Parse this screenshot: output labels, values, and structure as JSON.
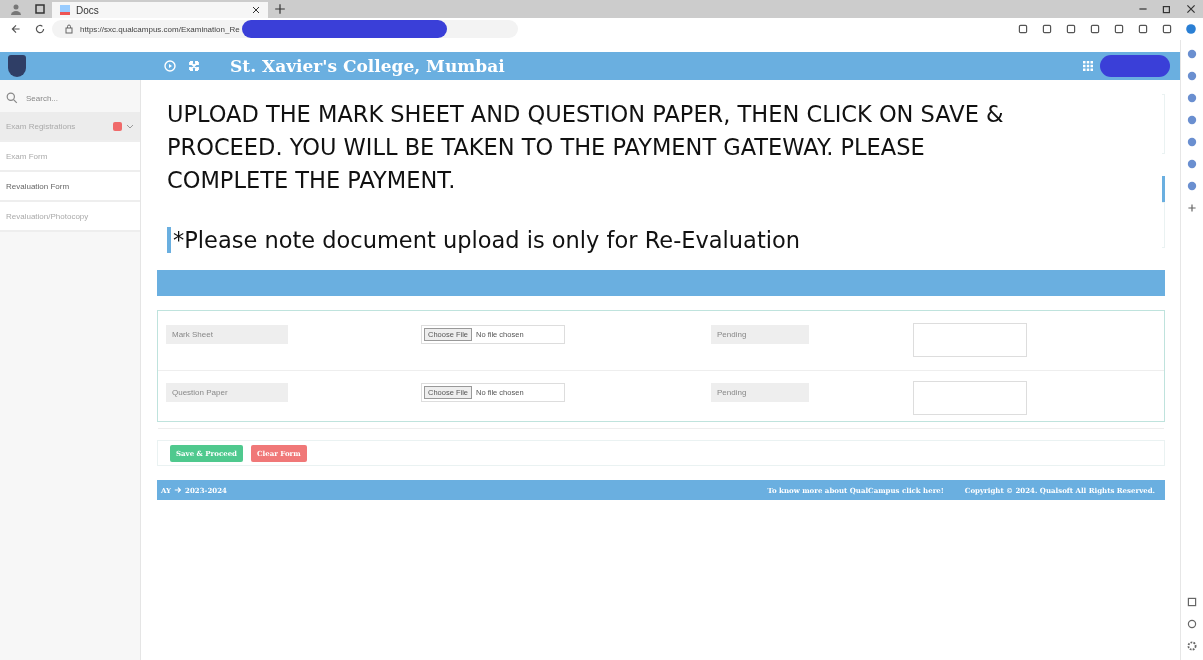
{
  "browser": {
    "tabs": [
      {
        "label": "Docs",
        "selected": true
      }
    ],
    "url": "https://sxc.qualcampus.com/Examination_Re"
  },
  "header": {
    "title": "St. Xavier's College, Mumbai"
  },
  "sidebar": {
    "search_placeholder": "Search...",
    "items": [
      {
        "label": "Exam Registrations",
        "selected": false,
        "expanded": true
      },
      {
        "label": "Exam Form",
        "selected": false,
        "expanded": false
      },
      {
        "label": "Revaluation Form",
        "selected": true,
        "expanded": false
      },
      {
        "label": "Revaluation/Photocopy",
        "selected": false,
        "expanded": false
      }
    ]
  },
  "notice": {
    "instruction": "UPLOAD THE MARK SHEET AND QUESTION PAPER, THEN CLICK ON SAVE & PROCEED. YOU WILL BE TAKEN TO THE PAYMENT GATEWAY. PLEASE COMPLETE THE PAYMENT.",
    "note": "*Please note document upload is only for Re-Evaluation"
  },
  "table": {
    "rows": [
      {
        "document": "Mark Sheet",
        "file_button": "Choose File",
        "file_status": "No file chosen",
        "upload_status": "Pending"
      },
      {
        "document": "Question Paper",
        "file_button": "Choose File",
        "file_status": "No file chosen",
        "upload_status": "Pending"
      }
    ]
  },
  "buttons": [
    {
      "label": "Save & Proceed",
      "kind": "primary"
    },
    {
      "label": "Clear Form",
      "kind": "danger"
    }
  ],
  "footer": {
    "year_prefix": "AY",
    "year": "2023-2024",
    "link": "To know more about QualCampus click here!",
    "copyright": "Copyright © 2024. Qualsoft All Rights Reserved."
  }
}
